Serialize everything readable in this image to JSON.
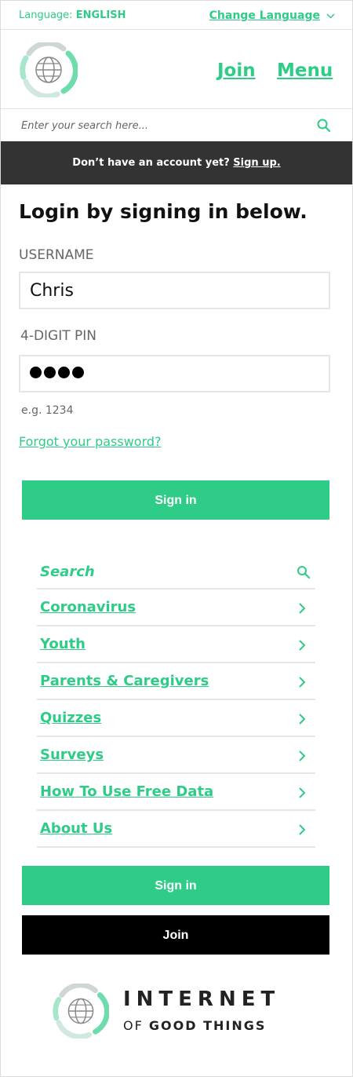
{
  "topbar": {
    "language_label": "Language:",
    "language_value": "ENGLISH",
    "change_language": "Change Language"
  },
  "header": {
    "join": "Join",
    "menu": "Menu"
  },
  "search": {
    "placeholder": "Enter your search here..."
  },
  "banner": {
    "text": "Don’t have an account yet?",
    "link": "Sign up."
  },
  "login": {
    "title": "Login by signing in below.",
    "username_label": "USERNAME",
    "username_value": "Chris",
    "pin_label": "4-DIGIT PIN",
    "pin_dot_count": 4,
    "pin_hint": "e.g. 1234",
    "forgot": "Forgot your password?",
    "sign_in": "Sign in"
  },
  "menu": {
    "search_label": "Search",
    "items": [
      {
        "label": "Coronavirus"
      },
      {
        "label": "Youth"
      },
      {
        "label": "Parents & Caregivers"
      },
      {
        "label": "Quizzes"
      },
      {
        "label": "Surveys"
      },
      {
        "label": "How To Use Free Data"
      },
      {
        "label": "About Us"
      }
    ]
  },
  "actions": {
    "sign_in": "Sign in",
    "join": "Join"
  },
  "footer": {
    "brand_line1": "INTERNET",
    "brand_line2_prefix": "OF",
    "brand_line2_rest": "GOOD THINGS"
  },
  "colors": {
    "accent": "#2ecc87",
    "banner_bg": "#333333",
    "text": "#111111"
  }
}
